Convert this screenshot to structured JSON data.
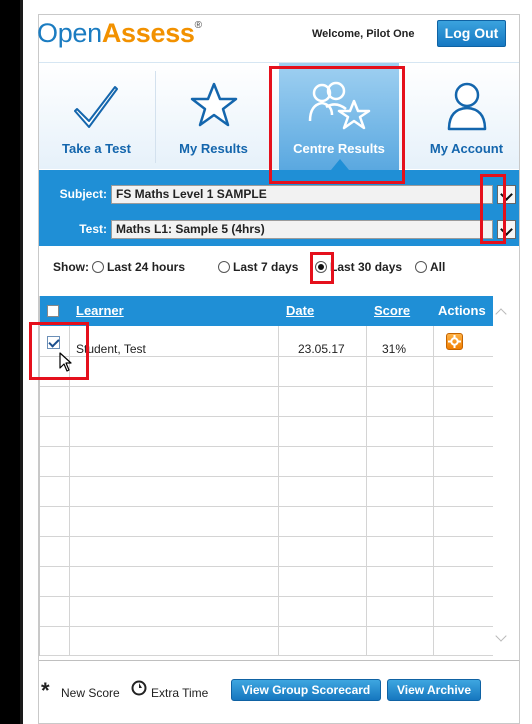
{
  "header": {
    "logo_prefix": "Open",
    "logo_accent": "Assess",
    "logo_mark": "®",
    "welcome": "Welcome,  Pilot One",
    "logout": "Log Out"
  },
  "nav": [
    {
      "label": "Take a Test",
      "icon": "checkmark-icon"
    },
    {
      "label": "My Results",
      "icon": "star-icon"
    },
    {
      "label": "Centre Results",
      "icon": "group-star-icon",
      "active": true
    },
    {
      "label": "My Account",
      "icon": "person-icon"
    }
  ],
  "filters": {
    "subject_label": "Subject:",
    "subject_value": "FS Maths Level 1 SAMPLE",
    "test_label": "Test:",
    "test_value": "Maths L1: Sample 5 (4hrs)"
  },
  "show": {
    "label": "Show:",
    "options": [
      "Last 24 hours",
      "Last 7 days",
      "Last 30 days",
      "All"
    ],
    "selected": "Last 30 days"
  },
  "table": {
    "headers": {
      "learner": "Learner",
      "date": "Date",
      "score": "Score",
      "actions": "Actions"
    },
    "rows": [
      {
        "learner": "Student, Test",
        "date": "23.05.17",
        "score": "31%",
        "checked": true
      }
    ]
  },
  "footer": {
    "star_glyph": "*",
    "new_score": "New Score",
    "extra_time": "Extra Time",
    "view_group_scorecard": "View Group Scorecard",
    "view_archive": "View Archive"
  },
  "colors": {
    "brand_blue": "#1f8fd6",
    "brand_orange": "#f29100",
    "highlight_red": "#e5101c"
  }
}
